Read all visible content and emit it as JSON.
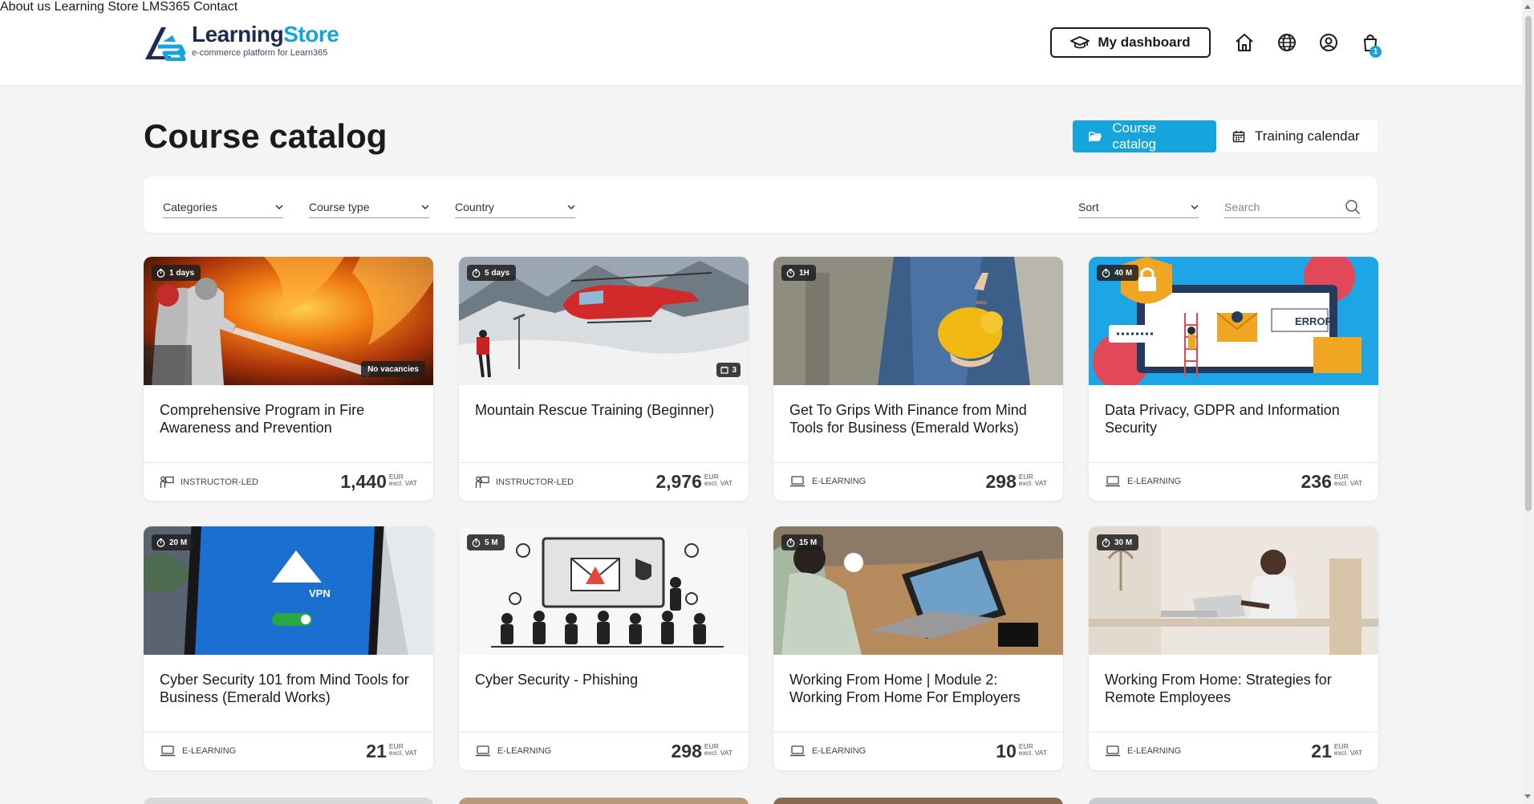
{
  "brand": {
    "name_part1": "Learning",
    "name_part2": "Store",
    "tagline": "e-commerce platform for Learn365",
    "colors": {
      "accent": "#15a4db",
      "navy": "#1d2b4f"
    }
  },
  "nav": {
    "items": [
      "About us",
      "Learning Store",
      "LMS365",
      "Contact"
    ],
    "dashboard_label": "My dashboard",
    "cart_count": "1",
    "icons": [
      "home-icon",
      "globe-icon",
      "user-icon",
      "cart-icon"
    ]
  },
  "page": {
    "title": "Course catalog",
    "views": {
      "catalog": "Course catalog",
      "calendar": "Training calendar"
    }
  },
  "filters": {
    "categories": "Categories",
    "course_type": "Course type",
    "country": "Country",
    "sort": "Sort",
    "search_placeholder": "Search"
  },
  "courses": [
    {
      "title": "Comprehensive Program in Fire Awareness and Prevention",
      "duration": "1 days",
      "status": "No vacancies",
      "type": "INSTRUCTOR-LED",
      "price": "1,440",
      "currency": "EUR",
      "vat": "excl. VAT"
    },
    {
      "title": "Mountain Rescue Training (Beginner)",
      "duration": "5 days",
      "seats": "3",
      "type": "INSTRUCTOR-LED",
      "price": "2,976",
      "currency": "EUR",
      "vat": "excl. VAT"
    },
    {
      "title": "Get To Grips With Finance from Mind Tools for Business (Emerald Works)",
      "duration": "1H",
      "type": "E-LEARNING",
      "price": "298",
      "currency": "EUR",
      "vat": "excl. VAT"
    },
    {
      "title": "Data Privacy, GDPR and Information Security",
      "duration": "40 M",
      "type": "E-LEARNING",
      "price": "236",
      "currency": "EUR",
      "vat": "excl. VAT",
      "image_text": "ERROR"
    },
    {
      "title": "Cyber Security 101 from Mind Tools for Business (Emerald Works)",
      "duration": "20 M",
      "type": "E-LEARNING",
      "price": "21",
      "currency": "EUR",
      "vat": "excl. VAT",
      "image_text": "VPN"
    },
    {
      "title": "Cyber Security - Phishing",
      "duration": "5 M",
      "type": "E-LEARNING",
      "price": "298",
      "currency": "EUR",
      "vat": "excl. VAT"
    },
    {
      "title": "Working From Home | Module 2: Working From Home For Employers",
      "duration": "15 M",
      "type": "E-LEARNING",
      "price": "10",
      "currency": "EUR",
      "vat": "excl. VAT"
    },
    {
      "title": "Working From Home: Strategies for Remote Employees",
      "duration": "30 M",
      "type": "E-LEARNING",
      "price": "21",
      "currency": "EUR",
      "vat": "excl. VAT"
    }
  ]
}
